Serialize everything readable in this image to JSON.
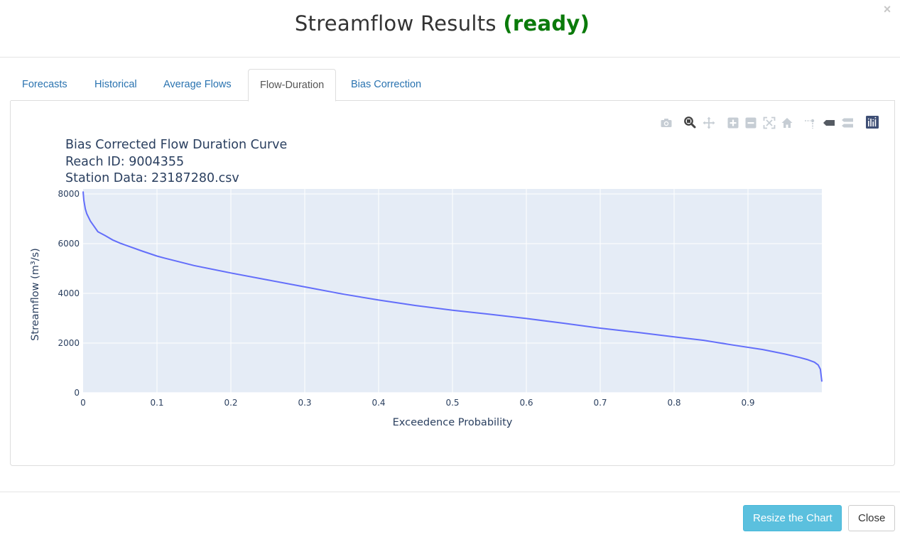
{
  "modal": {
    "title_prefix": "Streamflow Results",
    "title_status": "(ready)",
    "close_symbol": "×",
    "status_color": "#0a7a0a"
  },
  "tabs": [
    {
      "label": "Forecasts",
      "active": false
    },
    {
      "label": "Historical",
      "active": false
    },
    {
      "label": "Average Flows",
      "active": false
    },
    {
      "label": "Flow-Duration",
      "active": true
    },
    {
      "label": "Bias Correction",
      "active": false
    }
  ],
  "modebar": {
    "icons": [
      "camera-icon",
      "zoom-icon",
      "pan-icon",
      "zoom-in-icon",
      "zoom-out-icon",
      "autoscale-icon",
      "reset-axes-icon",
      "spike-lines-icon",
      "hover-closest-icon",
      "hover-compare-icon",
      "plotly-logo-icon"
    ]
  },
  "chart_data": {
    "type": "line",
    "title_lines": [
      "Bias Corrected Flow Duration Curve",
      "Reach ID: 9004355",
      "Station Data: 23187280.csv"
    ],
    "xlabel": "Exceedence Probability",
    "ylabel": "Streamflow (m³/s)",
    "xlim": [
      0,
      1
    ],
    "ylim": [
      0,
      8200
    ],
    "xticks": [
      "0",
      "0.1",
      "0.2",
      "0.3",
      "0.4",
      "0.5",
      "0.6",
      "0.7",
      "0.8",
      "0.9"
    ],
    "yticks": [
      "0",
      "2000",
      "4000",
      "6000",
      "8000"
    ],
    "grid": true,
    "line_color": "#636efa",
    "plot_bg": "#e5ecf6",
    "x": [
      0,
      0.001,
      0.003,
      0.005,
      0.01,
      0.02,
      0.03,
      0.04,
      0.05,
      0.06,
      0.08,
      0.1,
      0.11,
      0.15,
      0.2,
      0.25,
      0.3,
      0.35,
      0.4,
      0.45,
      0.5,
      0.55,
      0.6,
      0.65,
      0.7,
      0.75,
      0.8,
      0.84,
      0.88,
      0.92,
      0.95,
      0.97,
      0.98,
      0.99,
      0.995,
      0.998,
      1.0
    ],
    "y": [
      8100,
      7750,
      7400,
      7200,
      6900,
      6480,
      6320,
      6150,
      6020,
      5910,
      5700,
      5500,
      5420,
      5120,
      4820,
      4540,
      4260,
      3980,
      3730,
      3510,
      3320,
      3160,
      2990,
      2800,
      2600,
      2430,
      2250,
      2110,
      1920,
      1740,
      1560,
      1420,
      1340,
      1230,
      1120,
      950,
      450
    ]
  },
  "footer": {
    "resize_label": "Resize the Chart",
    "close_label": "Close"
  }
}
